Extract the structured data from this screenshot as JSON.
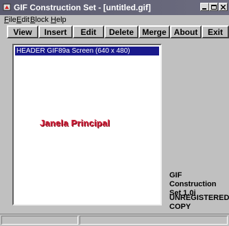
{
  "window": {
    "title": "GIF Construction Set - [untitled.gif]",
    "controls": [
      "minimize-icon",
      "maximize-icon",
      "close-icon"
    ]
  },
  "menu": {
    "file": {
      "u": "F",
      "rest": "ile"
    },
    "edit": {
      "u": "E",
      "rest": "dit"
    },
    "block": {
      "u": "B",
      "rest": "lock"
    },
    "help": {
      "u": "H",
      "rest": "elp"
    }
  },
  "toolbar": {
    "view": "View",
    "insert": "Insert",
    "edit": "Edit",
    "delete": "Delete",
    "merge": "Merge",
    "about": "About",
    "exit": "Exit"
  },
  "block_list": {
    "items": [
      "HEADER GIF89a Screen (640 x 480)"
    ]
  },
  "preview": {
    "text": "Janela Principal",
    "color": "#d0203a"
  },
  "info": {
    "version_line1": "GIF Construction",
    "version_line2": "Set 1.0i",
    "status_line1": "UNREGISTERED",
    "status_line2": "COPY"
  },
  "colors": {
    "title_bar": "#5a5a6e",
    "selection": "#1a1a8c",
    "face": "#c0c0c0"
  }
}
